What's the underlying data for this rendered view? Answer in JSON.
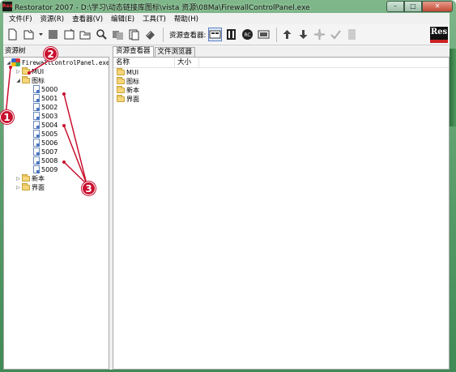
{
  "window": {
    "app_icon_text": "Res",
    "title": "Restorator 2007 - D:\\学习\\动态链接库图标\\vista 资源\\08Ma\\FirewallControlPanel.exe",
    "minimize_glyph": "–",
    "maximize_glyph": "□",
    "close_glyph": "✕"
  },
  "menu": [
    {
      "label": "文件(F)"
    },
    {
      "label": "资源(R)"
    },
    {
      "label": "查看器(V)"
    },
    {
      "label": "编辑(E)"
    },
    {
      "label": "工具(T)"
    },
    {
      "label": "帮助(H)"
    }
  ],
  "toolbar": {
    "viewer_label": "资源查看器:",
    "logo_text": "Res",
    "icons": [
      "new-file-icon",
      "open-icon",
      "save-icon",
      "save-as-icon",
      "open-folder-icon",
      "search-icon",
      "copy-icon",
      "export-icon",
      "book-icon",
      "viewer-mode-icon",
      "hex-view-icon",
      "rc-view-icon",
      "binary-view-icon",
      "move-up-icon",
      "move-down-icon",
      "navigate-icon",
      "check-icon",
      "document-icon"
    ]
  },
  "left_pane": {
    "header": "资源树",
    "tree": {
      "root": "FirewallControlPanel.exe",
      "nodes": [
        {
          "label": "MUI",
          "expander": "▷"
        },
        {
          "label": "图标",
          "expander": "◢"
        },
        {
          "label": "新本",
          "expander": "▷"
        },
        {
          "label": "界面",
          "expander": "▷"
        }
      ],
      "icon_children": [
        "5000",
        "5001",
        "5002",
        "5003",
        "5004",
        "5005",
        "5006",
        "5007",
        "5008",
        "5009"
      ]
    }
  },
  "right_pane": {
    "tabs": [
      {
        "label": "资源查看器",
        "active": true
      },
      {
        "label": "文件浏览器",
        "active": false
      }
    ],
    "columns": [
      "名称",
      "大小"
    ],
    "rows": [
      "MUI",
      "图标",
      "新本",
      "界面"
    ]
  },
  "annotations": {
    "badge_1": "1",
    "badge_2": "2",
    "badge_3": "3",
    "color": "#c8102e"
  },
  "colors": {
    "titlebar": "#5ea06e",
    "folder": "#f5d67a",
    "close_button": "#c24a34"
  }
}
